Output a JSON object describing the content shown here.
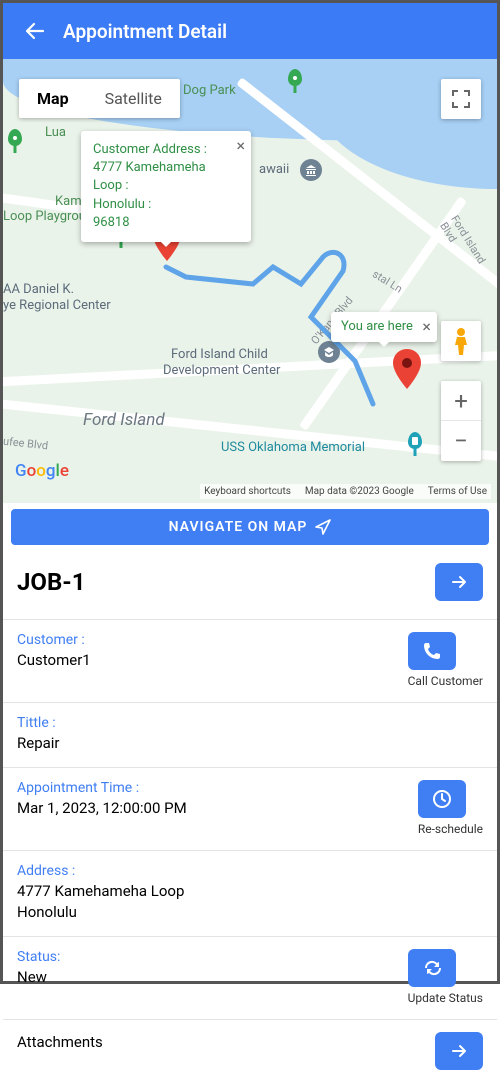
{
  "header": {
    "title": "Appointment Detail"
  },
  "map": {
    "tabs": {
      "map": "Map",
      "satellite": "Satellite"
    },
    "customer_popup": {
      "line1": "Customer Address :",
      "line2": "4777 Kamehameha Loop :",
      "line3": "Honolulu :",
      "line4": "96818"
    },
    "you_are_here": "You are here",
    "labels": {
      "dog_park": "Dog Park",
      "loop_playground_1": "Kam",
      "loop_playground_2": "Loop Playground",
      "regional_1": "AA Daniel K.",
      "regional_2": "ye Regional Center",
      "ford_island_1": "Ford Island Child",
      "ford_island_2": "Development Center",
      "ford_island": "Ford Island",
      "uss_oklahoma": "USS Oklahoma Memorial",
      "hawaii": "awaii",
      "ford_island_blvd": "Ford Island Blvd",
      "okane_blvd": "O'Kane Blvd",
      "istal_ln": "stal Ln",
      "ufee_blvd": "ufee Blvd"
    },
    "footer": {
      "shortcuts": "Keyboard shortcuts",
      "attribution": "Map data ©2023 Google",
      "terms": "Terms of Use"
    },
    "navigate_button": "NAVIGATE ON MAP"
  },
  "job": {
    "title": "JOB-1"
  },
  "rows": {
    "customer": {
      "label": "Customer :",
      "value": "Customer1",
      "action_caption": "Call Customer"
    },
    "title_row": {
      "label": "Tittle :",
      "value": "Repair"
    },
    "appt_time": {
      "label": "Appointment Time :",
      "value": "Mar 1, 2023, 12:00:00 PM",
      "action_caption": "Re-schedule"
    },
    "address": {
      "label": "Address :",
      "value_line1": "4777 Kamehameha Loop",
      "value_line2": "Honolulu"
    },
    "status": {
      "label": "Status:",
      "value": "New",
      "action_caption": "Update Status"
    },
    "attachments": {
      "label": "Attachments"
    }
  }
}
